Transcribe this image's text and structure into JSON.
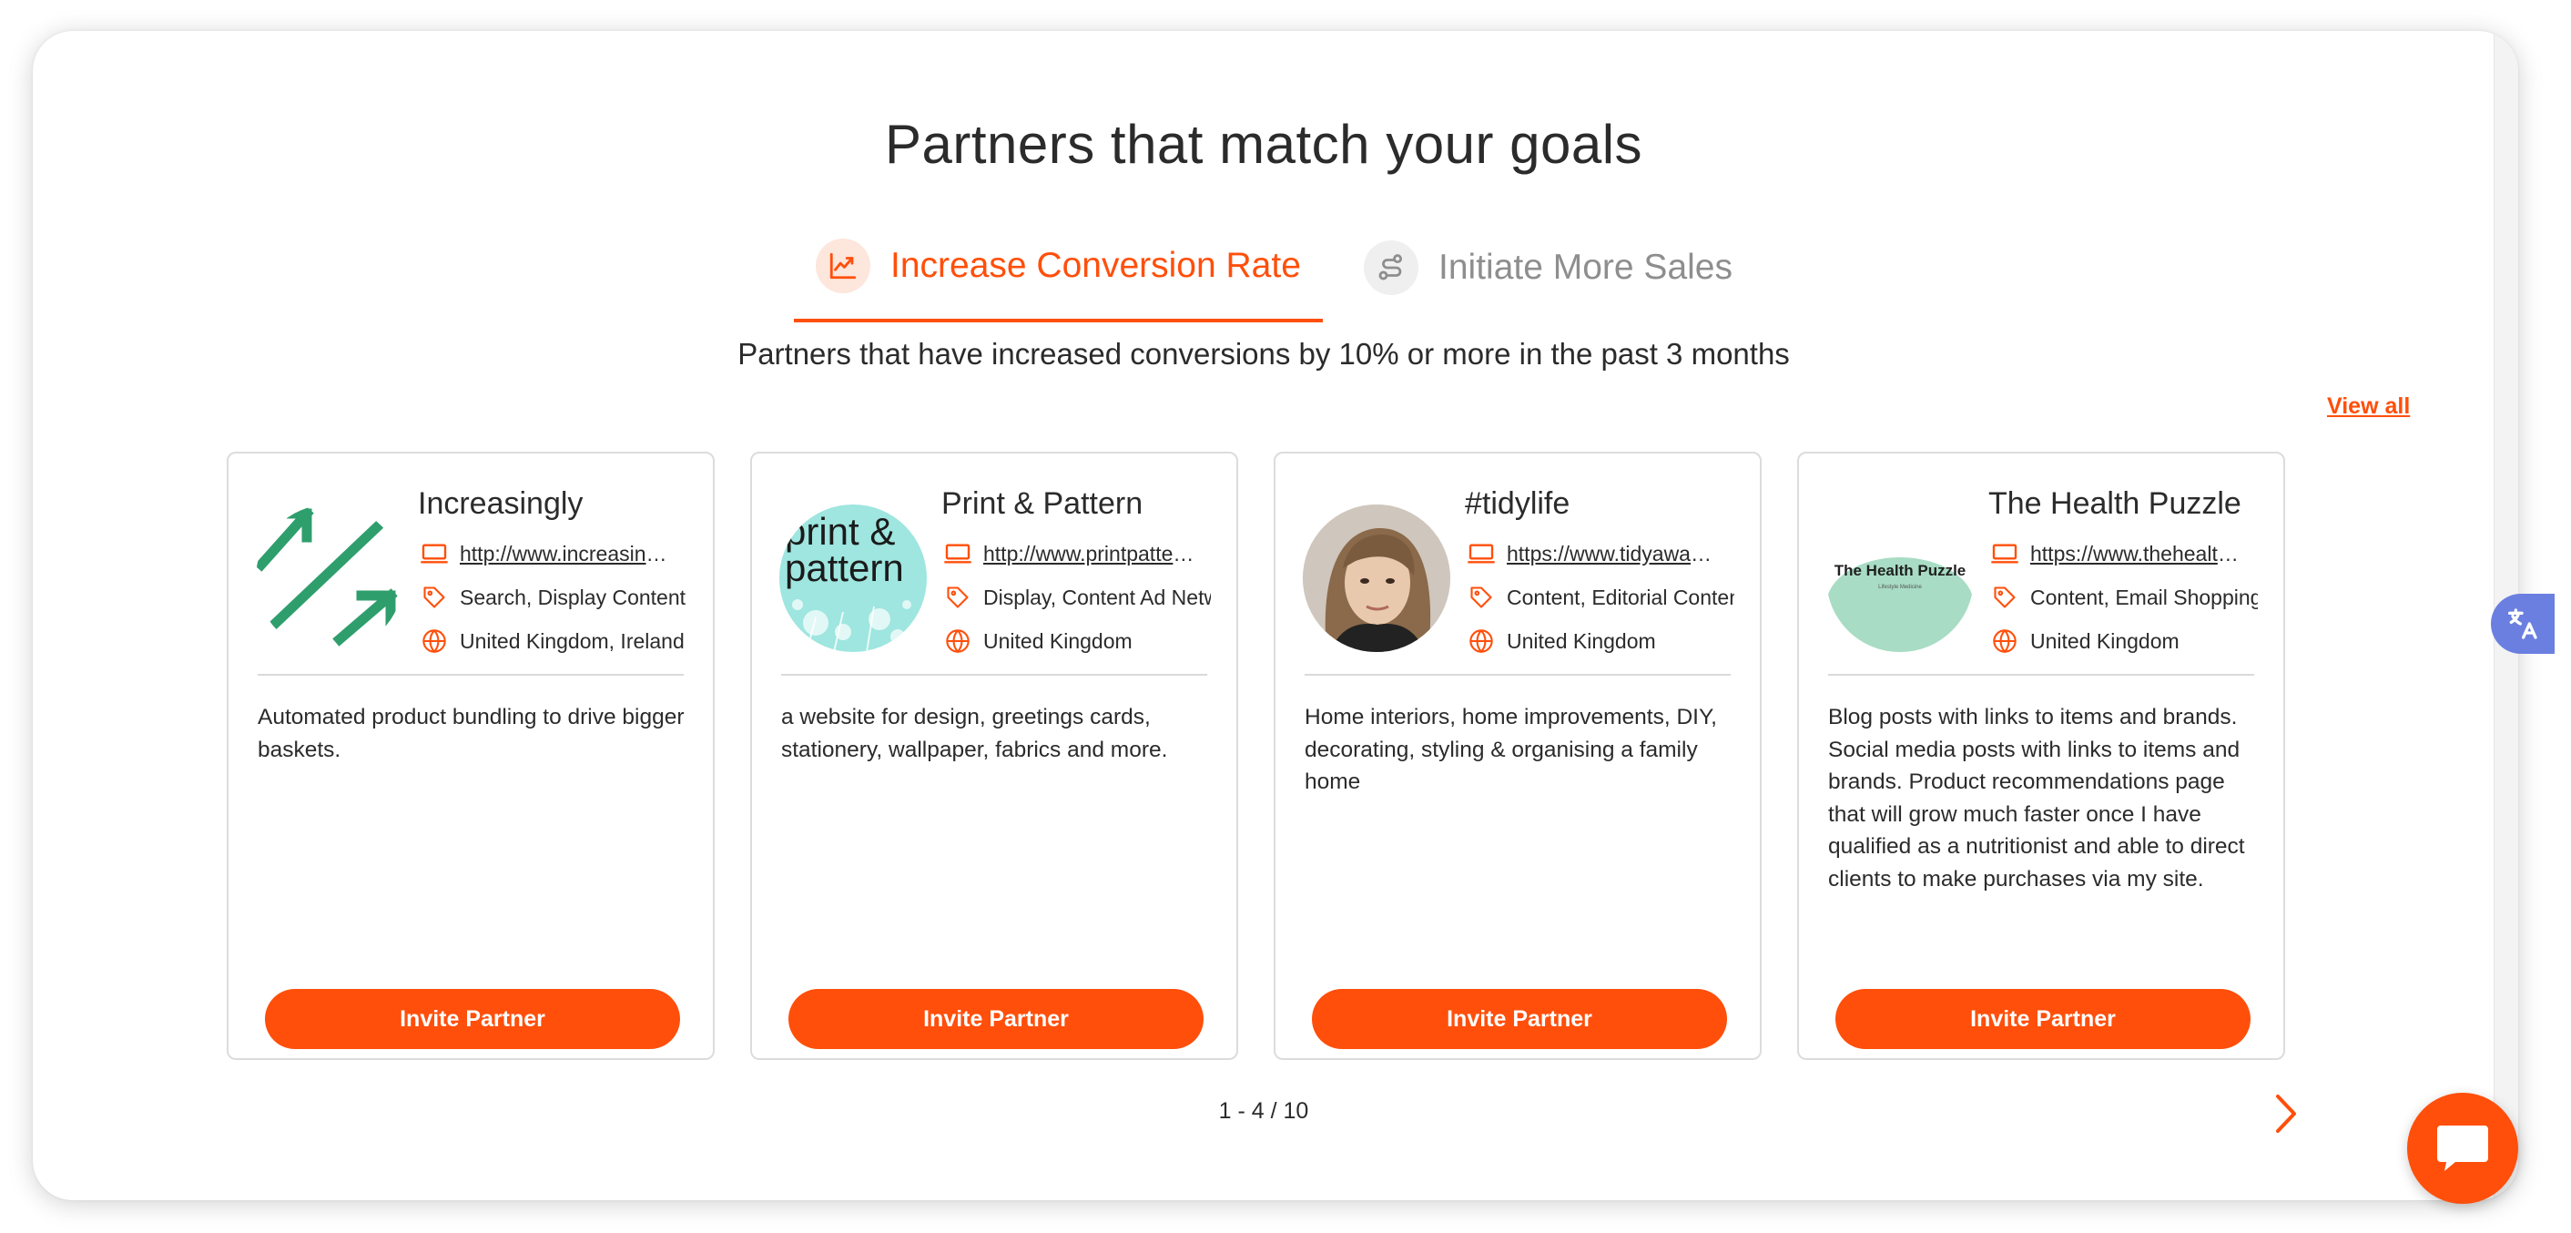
{
  "header": {
    "title": "Partners that match your goals"
  },
  "tabs": [
    {
      "label": "Increase Conversion Rate",
      "icon": "chart-trend-icon",
      "active": true
    },
    {
      "label": "Initiate More Sales",
      "icon": "route-icon",
      "active": false
    }
  ],
  "subtitle": "Partners that have increased conversions by 10% or more in the past 3 months",
  "view_all_label": "View all",
  "cards": [
    {
      "name": "Increasingly",
      "url": "http://www.increasingly.com",
      "categories": "Search, Display Content",
      "location": "United Kingdom, Ireland",
      "description": "Automated product bundling to drive bigger baskets.",
      "logo": "arrows-logo"
    },
    {
      "name": "Print & Pattern",
      "url": "http://www.printpattern.com",
      "categories": "Display, Content Ad Network",
      "location": "United Kingdom",
      "description": "a website for design, greetings cards, stationery, wallpaper, fabrics and more.",
      "logo": "print-pattern-logo",
      "logo_text_line1": "print &",
      "logo_text_line2": "pattern"
    },
    {
      "name": "#tidylife",
      "url": "https://www.tidyawaytoday.co.uk",
      "categories": "Content, Editorial Content",
      "location": "United Kingdom",
      "description": "Home interiors, home improvements, DIY, decorating, styling & organising a family home",
      "logo": "profile-photo"
    },
    {
      "name": "The Health Puzzle",
      "url": "https://www.thehealthpuzzle.com",
      "categories": "Content, Email Shopping",
      "location": "United Kingdom",
      "description": "Blog posts with links to items and brands. Social media posts with links to items and brands. Product recommendations page that will grow much faster once I have qualified as a nutritionist and able to direct clients to make purchases via my site.",
      "logo": "health-puzzle-logo",
      "logo_text_line1": "The Health Puzzle",
      "logo_text_line2": "Lifestyle Medicine"
    }
  ],
  "invite_label": "Invite Partner",
  "pagination": "1 - 4 / 10",
  "colors": {
    "accent": "#ff4f0b",
    "accent_light": "#fde6dc",
    "muted_text": "#8e8e8e",
    "border": "#dcdcdc",
    "translate_button": "#6b7fe0"
  }
}
